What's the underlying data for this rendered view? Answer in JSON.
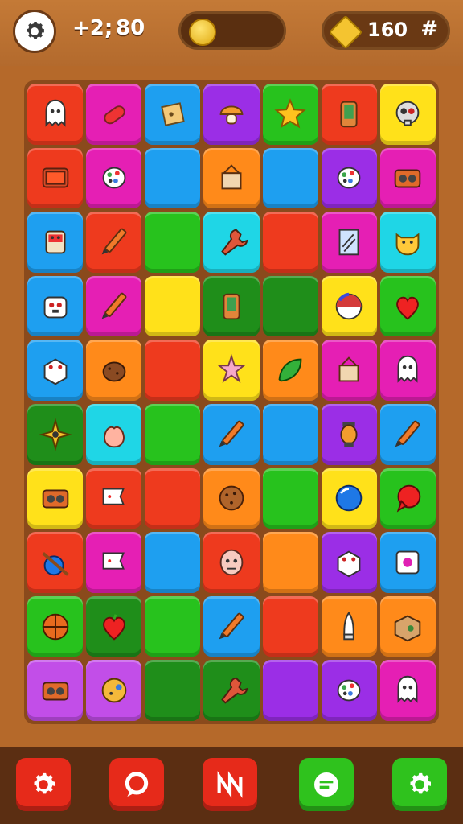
{
  "header": {
    "moves_label": "+2;",
    "score_value": "80",
    "gems_value": "160",
    "menu_glyph": "#",
    "settings_icon": "gear-icon",
    "coin_icon": "coin-icon",
    "gem_icon": "gem-icon",
    "progress_fraction": 0.0
  },
  "colors": {
    "red": "#ee3a1e",
    "magenta": "#e51fb4",
    "blue": "#1e9ff0",
    "purple": "#9b2ee6",
    "green": "#27c21d",
    "yellow": "#ffe11a",
    "orange": "#ff8a1a",
    "cyan": "#1fd6e6",
    "darkgreen": "#1f8e1a",
    "pink": "#f5a0d8",
    "violet": "#c24ee8"
  },
  "board": {
    "rows": [
      [
        {
          "color": "red",
          "icon": "ghost-icon"
        },
        {
          "color": "magenta",
          "icon": "candy-icon"
        },
        {
          "color": "blue",
          "icon": "card-icon"
        },
        {
          "color": "purple",
          "icon": "mushroom-icon"
        },
        {
          "color": "green",
          "icon": "star-icon"
        },
        {
          "color": "red",
          "icon": "phone-icon"
        },
        {
          "color": "yellow",
          "icon": "skull-icon"
        }
      ],
      [
        {
          "color": "red",
          "icon": "tv-icon"
        },
        {
          "color": "magenta",
          "icon": "spotted-egg-icon"
        },
        {
          "color": "blue",
          "icon": ""
        },
        {
          "color": "orange",
          "icon": "frame-icon"
        },
        {
          "color": "blue",
          "icon": ""
        },
        {
          "color": "purple",
          "icon": "spotted-egg-icon"
        },
        {
          "color": "magenta",
          "icon": "radio-icon"
        }
      ],
      [
        {
          "color": "blue",
          "icon": "box-face-icon"
        },
        {
          "color": "red",
          "icon": "pencil-icon"
        },
        {
          "color": "green",
          "icon": ""
        },
        {
          "color": "cyan",
          "icon": "wrench-icon"
        },
        {
          "color": "red",
          "icon": ""
        },
        {
          "color": "magenta",
          "icon": "mirror-icon"
        },
        {
          "color": "cyan",
          "icon": "cat-face-icon"
        }
      ],
      [
        {
          "color": "blue",
          "icon": "dice-face-icon"
        },
        {
          "color": "magenta",
          "icon": "pencil-icon"
        },
        {
          "color": "yellow",
          "icon": ""
        },
        {
          "color": "darkgreen",
          "icon": "phone-icon"
        },
        {
          "color": "darkgreen",
          "icon": ""
        },
        {
          "color": "yellow",
          "icon": "ball-face-icon"
        },
        {
          "color": "green",
          "icon": "heart-apple-icon"
        }
      ],
      [
        {
          "color": "blue",
          "icon": "dice-icon"
        },
        {
          "color": "orange",
          "icon": "potato-icon"
        },
        {
          "color": "red",
          "icon": ""
        },
        {
          "color": "yellow",
          "icon": "starfish-icon"
        },
        {
          "color": "orange",
          "icon": "leaf-icon"
        },
        {
          "color": "magenta",
          "icon": "frame-icon"
        },
        {
          "color": "magenta",
          "icon": "ghost-icon"
        }
      ],
      [
        {
          "color": "darkgreen",
          "icon": "shuriken-icon"
        },
        {
          "color": "cyan",
          "icon": "peach-icon"
        },
        {
          "color": "green",
          "icon": ""
        },
        {
          "color": "blue",
          "icon": "pencil-icon"
        },
        {
          "color": "blue",
          "icon": ""
        },
        {
          "color": "purple",
          "icon": "lantern-icon"
        },
        {
          "color": "blue",
          "icon": "pencil-icon"
        }
      ],
      [
        {
          "color": "yellow",
          "icon": "radio-icon"
        },
        {
          "color": "red",
          "icon": "flag-icon"
        },
        {
          "color": "red",
          "icon": ""
        },
        {
          "color": "orange",
          "icon": "cookie-icon"
        },
        {
          "color": "green",
          "icon": ""
        },
        {
          "color": "yellow",
          "icon": "ball-icon"
        },
        {
          "color": "green",
          "icon": "speech-bubble-icon"
        }
      ],
      [
        {
          "color": "red",
          "icon": "bomb-icon"
        },
        {
          "color": "magenta",
          "icon": "flag-icon"
        },
        {
          "color": "blue",
          "icon": ""
        },
        {
          "color": "red",
          "icon": "skull-face-icon"
        },
        {
          "color": "orange",
          "icon": ""
        },
        {
          "color": "purple",
          "icon": "dice-icon"
        },
        {
          "color": "blue",
          "icon": "square-icon"
        }
      ],
      [
        {
          "color": "green",
          "icon": "basketball-icon"
        },
        {
          "color": "darkgreen",
          "icon": "heart-apple-icon"
        },
        {
          "color": "green",
          "icon": ""
        },
        {
          "color": "blue",
          "icon": "pencil-icon"
        },
        {
          "color": "red",
          "icon": ""
        },
        {
          "color": "orange",
          "icon": "rocket-icon"
        },
        {
          "color": "orange",
          "icon": "box-icon"
        }
      ],
      [
        {
          "color": "violet",
          "icon": "radio-icon"
        },
        {
          "color": "violet",
          "icon": "orb-icon"
        },
        {
          "color": "darkgreen",
          "icon": ""
        },
        {
          "color": "darkgreen",
          "icon": "wrench-icon"
        },
        {
          "color": "purple",
          "icon": ""
        },
        {
          "color": "purple",
          "icon": "spotted-egg-icon"
        },
        {
          "color": "magenta",
          "icon": "ghost-icon"
        }
      ]
    ]
  },
  "bottom_bar": {
    "buttons": [
      {
        "name": "settings-button",
        "icon": "gear-icon",
        "color": "#e62a1a"
      },
      {
        "name": "chat-button",
        "icon": "chat-icon",
        "color": "#e62a1a"
      },
      {
        "name": "shuffle-button",
        "icon": "shuffle-icon",
        "color": "#e62a1a"
      },
      {
        "name": "menu-button",
        "icon": "menu-icon",
        "color": "#2fc21d"
      },
      {
        "name": "options-button",
        "icon": "gear-icon",
        "color": "#2fc21d"
      }
    ]
  }
}
